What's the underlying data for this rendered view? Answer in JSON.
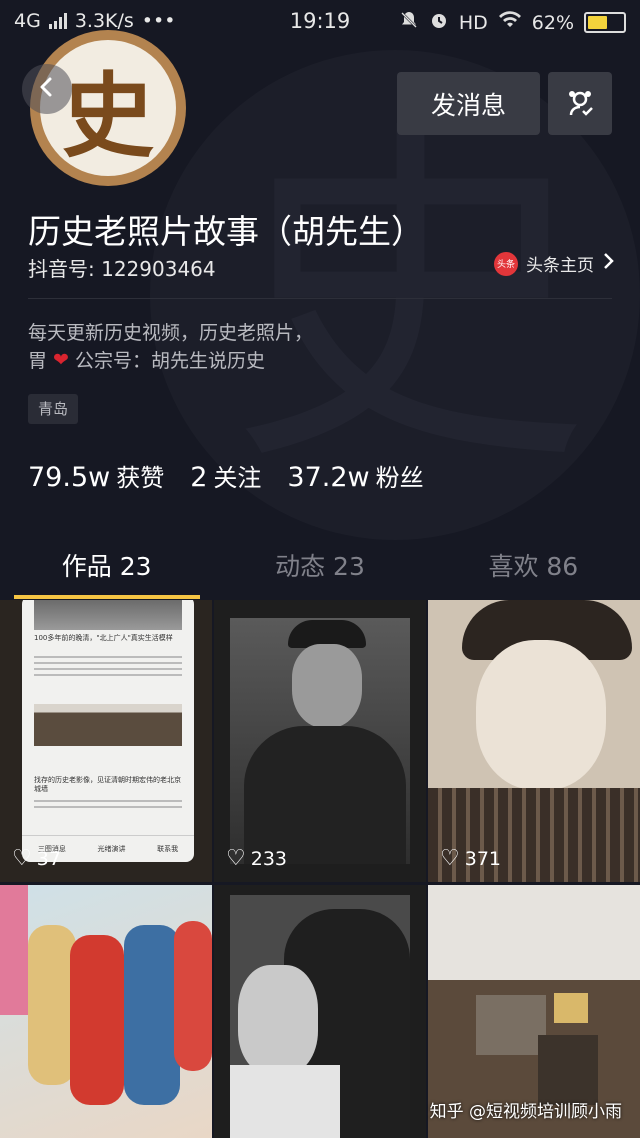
{
  "status_bar": {
    "network": "4G",
    "speed": "3.3K/s",
    "dots": "•••",
    "time": "19:19",
    "hd": "HD",
    "battery": "62%",
    "battery_level": 0.62
  },
  "profile": {
    "avatar_char": "史",
    "watermark_char": "史",
    "nickname": "历史老照片故事（胡先生）",
    "douyin_id": "抖音号: 122903464",
    "toutiao_badge": "头条",
    "toutiao_link": "头条主页",
    "bio_line1": "每天更新历史视频，历史老照片，",
    "bio_line2_prefix": "胃",
    "bio_line2_text": "公宗号：胡先生说历史",
    "location": "青岛"
  },
  "actions": {
    "message_button": "发消息"
  },
  "stats": {
    "likes_num": "79.5w",
    "likes_label": "获赞",
    "following_num": "2",
    "following_label": "关注",
    "followers_num": "37.2w",
    "followers_label": "粉丝"
  },
  "tabs": [
    {
      "label": "作品 23"
    },
    {
      "label": "动态 23"
    },
    {
      "label": "喜欢 86"
    }
  ],
  "videos": [
    {
      "likes": "37"
    },
    {
      "likes": "233"
    },
    {
      "likes": "371"
    },
    {
      "likes": ""
    },
    {
      "likes": ""
    },
    {
      "likes": ""
    }
  ],
  "video0_texts": {
    "headline1": "100多年前的晚清，\"北上广人\"真实生活模样",
    "headline2": "找存的历史老影像，见证清朝时期宏伟的老北京城墙",
    "btn1": "三图消息",
    "btn2": "光绪演讲",
    "btn3": "联系我"
  },
  "watermark": "知乎 @短视频培训顾小雨",
  "colors": {
    "background": "#161823",
    "accent_tab": "#f6c544",
    "button_bg": "#393b44",
    "heart_red": "#d9242f"
  }
}
